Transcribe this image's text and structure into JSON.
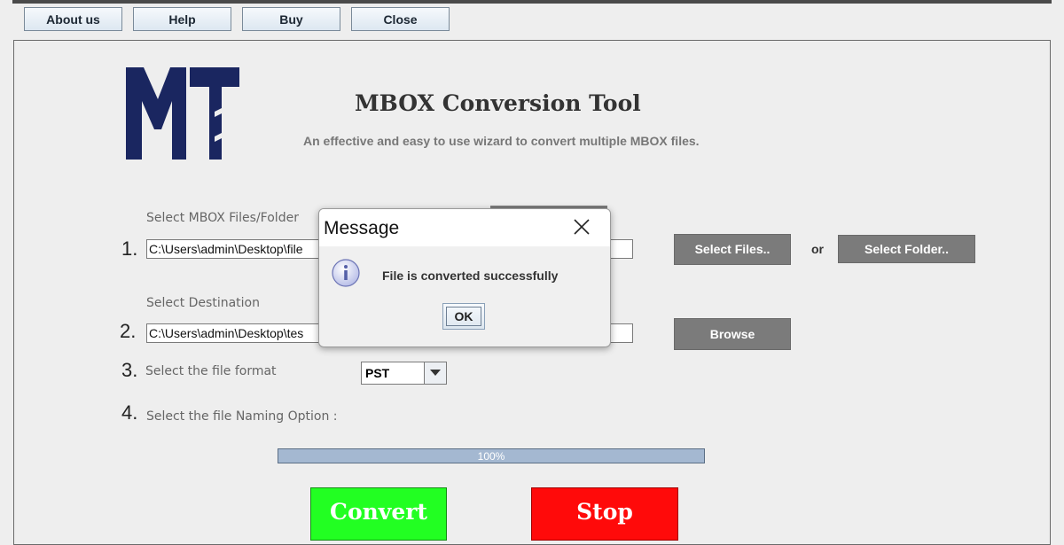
{
  "toolbar": {
    "about_label": "About us",
    "help_label": "Help",
    "buy_label": "Buy",
    "close_label": "Close"
  },
  "header": {
    "title": "MBOX Conversion Tool",
    "subtitle": "An effective and easy to use wizard to convert multiple MBOX files."
  },
  "step1": {
    "number": "1.",
    "label": "Select MBOX Files/Folder",
    "path_value": "C:\\Users\\admin\\Desktop\\file",
    "select_files_label": "Select Files..",
    "or_label": "or",
    "select_folder_label": "Select Folder.."
  },
  "step2": {
    "number": "2.",
    "label": "Select Destination",
    "path_value": "C:\\Users\\admin\\Desktop\\tes",
    "browse_label": "Browse"
  },
  "step3": {
    "number": "3.",
    "label": "Select the file format",
    "format_value": "PST"
  },
  "step4": {
    "number": "4.",
    "label": "Select the file Naming Option :"
  },
  "progress": {
    "value": 100,
    "text": "100%"
  },
  "actions": {
    "convert_label": "Convert",
    "stop_label": "Stop"
  },
  "dialog": {
    "title": "Message",
    "message": "File is converted successfully",
    "ok_label": "OK",
    "icon": "info-icon"
  },
  "colors": {
    "convert": "#22ff22",
    "stop": "#ff0a0a",
    "grey_button": "#7b7b7b",
    "logo_navy": "#1a2660"
  }
}
